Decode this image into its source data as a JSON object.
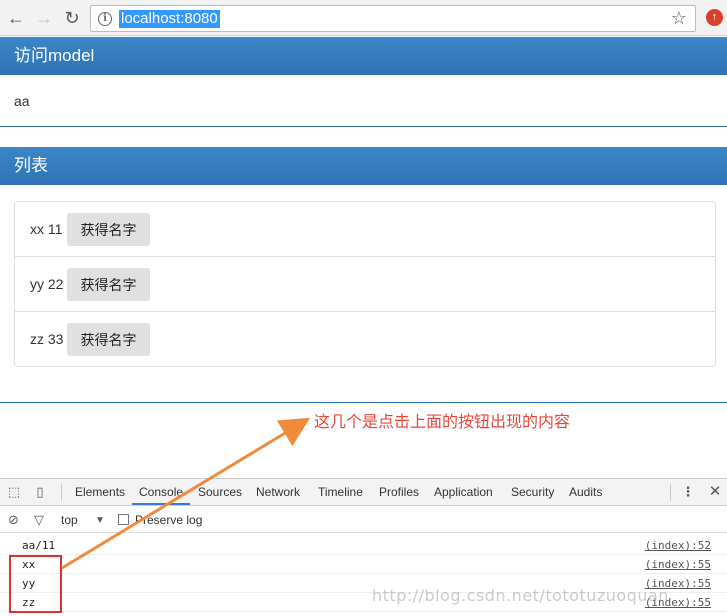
{
  "browser": {
    "url": "localhost:8080",
    "back_icon": "arrow-left",
    "forward_icon": "arrow-right",
    "reload_icon": "reload",
    "info_icon": "i",
    "bookmark_icon": "star",
    "extension_icon": "red-circle-up"
  },
  "panels": {
    "model": {
      "title": "访问model",
      "content": "aa"
    },
    "list": {
      "title": "列表",
      "items": [
        {
          "label": "xx 11",
          "button": "获得名字"
        },
        {
          "label": "yy 22",
          "button": "获得名字"
        },
        {
          "label": "zz 33",
          "button": "获得名字"
        }
      ]
    }
  },
  "annotation": {
    "text": "这几个是点击上面的按钮出现的内容",
    "color": "#e8463a"
  },
  "devtools": {
    "tabs": [
      "Elements",
      "Console",
      "Sources",
      "Network",
      "Timeline",
      "Profiles",
      "Application",
      "Security",
      "Audits"
    ],
    "active_tab": "Console",
    "context": "top",
    "preserve_log_label": "Preserve log",
    "logs": [
      {
        "message": "aa/11",
        "source": "(index):52"
      },
      {
        "message": "xx",
        "source": "(index):55"
      },
      {
        "message": "yy",
        "source": "(index):55"
      },
      {
        "message": "zz",
        "source": "(index):55"
      }
    ]
  },
  "watermark": "http://blog.csdn.net/tototuzuoquan",
  "colors": {
    "panel_header": "#337ab7",
    "highlight": "#e0302a",
    "url_selection": "#3399ff"
  }
}
